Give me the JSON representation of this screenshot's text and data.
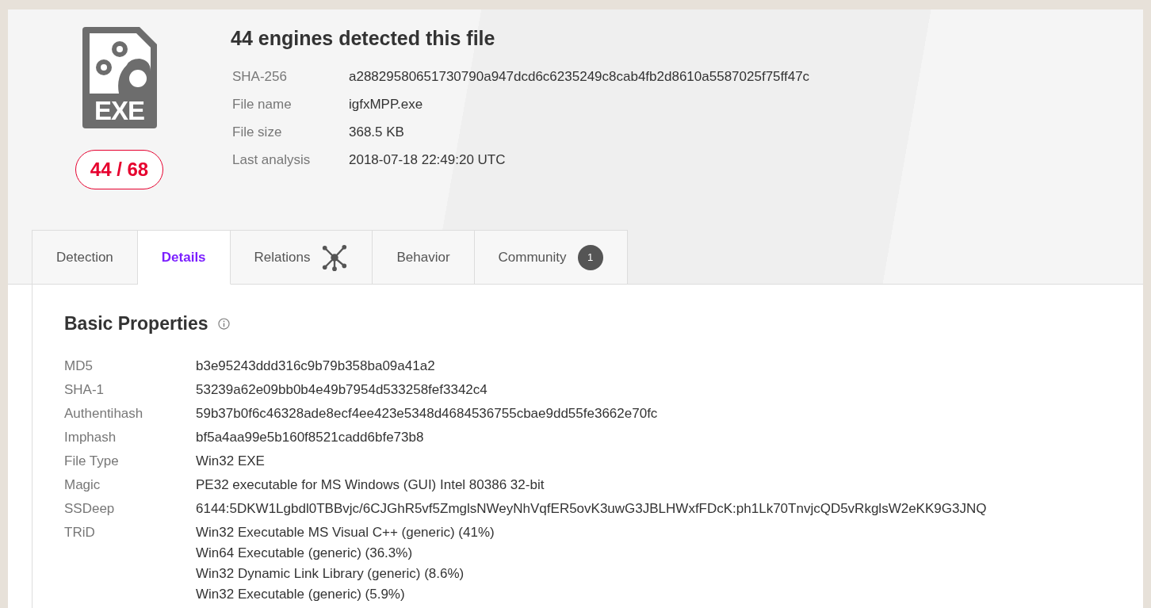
{
  "file_icon_label": "EXE",
  "detection_ratio": "44 / 68",
  "title": "44 engines detected this file",
  "meta": [
    {
      "label": "SHA-256",
      "value": "a28829580651730790a947dcd6c6235249c8cab4fb2d8610a5587025f75ff47c"
    },
    {
      "label": "File name",
      "value": "igfxMPP.exe"
    },
    {
      "label": "File size",
      "value": "368.5 KB"
    },
    {
      "label": "Last analysis",
      "value": "2018-07-18 22:49:20 UTC"
    }
  ],
  "tabs": [
    {
      "label": "Detection",
      "selected": false
    },
    {
      "label": "Details",
      "selected": true
    },
    {
      "label": "Relations",
      "selected": false,
      "kind": "icon"
    },
    {
      "label": "Behavior",
      "selected": false
    },
    {
      "label": "Community",
      "selected": false,
      "badge": "1"
    }
  ],
  "section": {
    "title": "Basic Properties",
    "properties": [
      {
        "label": "MD5",
        "values": [
          "b3e95243ddd316c9b79b358ba09a41a2"
        ]
      },
      {
        "label": "SHA-1",
        "values": [
          "53239a62e09bb0b4e49b7954d533258fef3342c4"
        ]
      },
      {
        "label": "Authentihash",
        "values": [
          "59b37b0f6c46328ade8ecf4ee423e5348d4684536755cbae9dd55fe3662e70fc"
        ]
      },
      {
        "label": "Imphash",
        "values": [
          "bf5a4aa99e5b160f8521cadd6bfe73b8"
        ]
      },
      {
        "label": "File Type",
        "values": [
          "Win32 EXE"
        ]
      },
      {
        "label": "Magic",
        "values": [
          "PE32 executable for MS Windows (GUI) Intel 80386 32-bit"
        ]
      },
      {
        "label": "SSDeep",
        "values": [
          "6144:5DKW1Lgbdl0TBBvjc/6CJGhR5vf5ZmglsNWeyNhVqfER5ovK3uwG3JBLHWxfFDcK:ph1Lk70TnvjcQD5vRkglsW2eKK9G3JNQ"
        ]
      },
      {
        "label": "TRiD",
        "values": [
          "Win32 Executable MS Visual C++ (generic) (41%)",
          "Win64 Executable (generic) (36.3%)",
          "Win32 Dynamic Link Library (generic) (8.6%)",
          "Win32 Executable (generic) (5.9%)"
        ]
      }
    ]
  }
}
